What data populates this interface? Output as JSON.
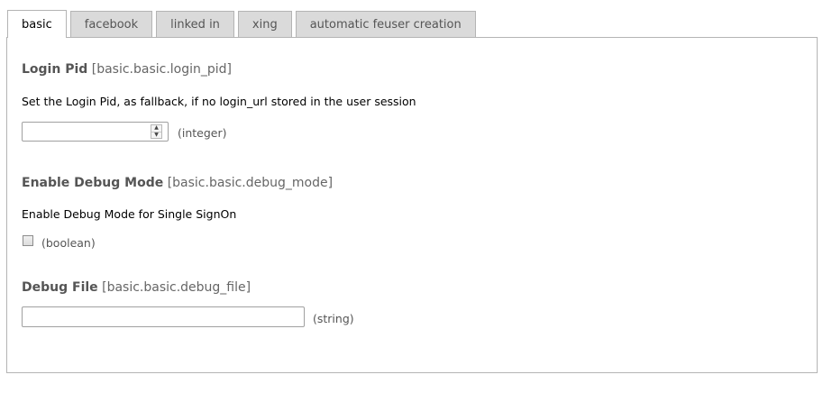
{
  "tabs": [
    {
      "label": "basic",
      "active": true
    },
    {
      "label": "facebook",
      "active": false
    },
    {
      "label": "linked in",
      "active": false
    },
    {
      "label": "xing",
      "active": false
    },
    {
      "label": "automatic feuser creation",
      "active": false
    }
  ],
  "fields": {
    "login_pid": {
      "name": "Login Pid",
      "key": "[basic.basic.login_pid]",
      "description": "Set the Login Pid, as fallback, if no login_url stored in the user session",
      "value": "",
      "type_hint": "(integer)"
    },
    "debug_mode": {
      "name": "Enable Debug Mode",
      "key": "[basic.basic.debug_mode]",
      "description": "Enable Debug Mode for Single SignOn",
      "checked": false,
      "type_hint": "(boolean)"
    },
    "debug_file": {
      "name": "Debug File",
      "key": "[basic.basic.debug_file]",
      "value": "",
      "type_hint": "(string)"
    }
  },
  "icons": {
    "spin_up": "▲",
    "spin_down": "▼"
  },
  "colors": {
    "tab_inactive_bg": "#dadada",
    "border": "#b4b4b4",
    "title_text": "#555555"
  }
}
